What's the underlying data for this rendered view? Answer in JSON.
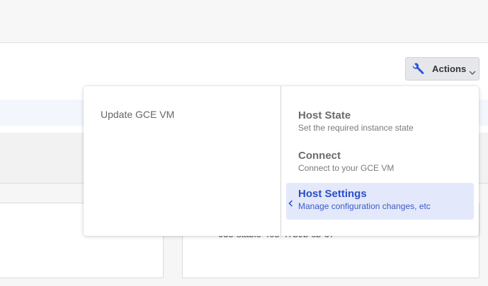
{
  "toolbar": {
    "actions_label": "Actions",
    "actions_icon": "wrench-icon",
    "dropdown_icon": "chevron-down-icon"
  },
  "background": {
    "card_text": "035-stable-405-47b9b-cb-67"
  },
  "dropdown": {
    "left_item": "Update GCE VM",
    "items": [
      {
        "title": "Host State",
        "description": "Set the required instance state"
      },
      {
        "title": "Connect",
        "description": "Connect to your GCE VM"
      },
      {
        "title": "Host Settings",
        "description": "Manage configuration changes, etc",
        "active": true
      }
    ]
  },
  "colors": {
    "accent": "#2a4fc7",
    "active_bg": "#e3e9fb",
    "wrench": "#2e57d6"
  }
}
